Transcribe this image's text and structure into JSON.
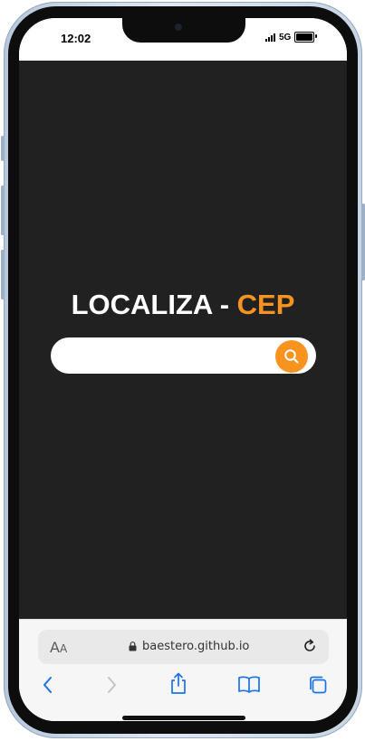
{
  "status_bar": {
    "time": "12:02",
    "network": "5G"
  },
  "page": {
    "title_main": "LOCALIZA - ",
    "title_accent": "CEP",
    "accent_color": "#f7931e",
    "background_color": "#212121",
    "search": {
      "value": "",
      "placeholder": "",
      "button_icon": "search-icon"
    }
  },
  "browser": {
    "text_size_label_large": "A",
    "text_size_label_small": "A",
    "url": "baestero.github.io",
    "icons": {
      "lock": "lock-icon",
      "reload": "reload-icon",
      "back": "back-icon",
      "forward": "forward-icon",
      "share": "share-icon",
      "bookmarks": "bookmarks-icon",
      "tabs": "tabs-icon"
    }
  }
}
